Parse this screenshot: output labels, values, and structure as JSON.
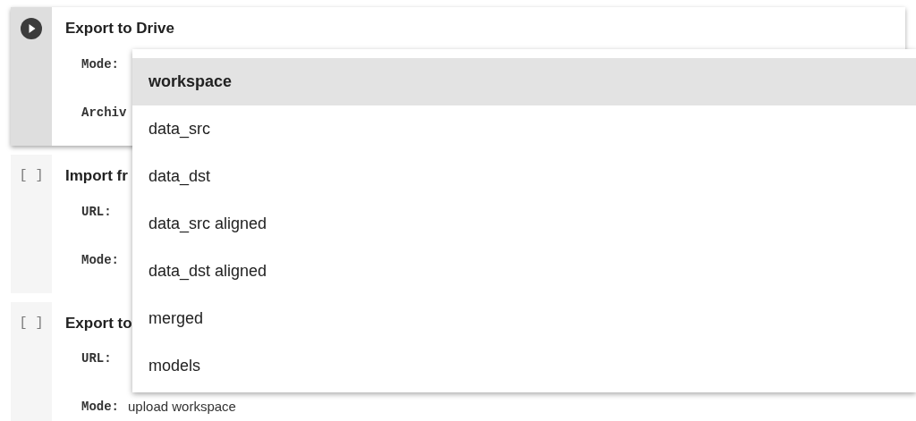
{
  "cells": [
    {
      "running": true,
      "title": "Export to Drive",
      "fields": [
        {
          "label": "Mode:"
        },
        {
          "label": "Archiv"
        }
      ]
    },
    {
      "running": false,
      "marker": "[ ]",
      "title": "Import fr",
      "fields": [
        {
          "label": "URL:"
        },
        {
          "label": "Mode:"
        }
      ]
    },
    {
      "running": false,
      "marker": "[ ]",
      "title": "Export to",
      "fields": [
        {
          "label": "URL:"
        },
        {
          "label": "Mode:",
          "value": "upload workspace"
        }
      ]
    }
  ],
  "dropdown": {
    "options": [
      {
        "label": "workspace",
        "selected": true
      },
      {
        "label": "data_src",
        "selected": false
      },
      {
        "label": "data_dst",
        "selected": false
      },
      {
        "label": "data_src aligned",
        "selected": false
      },
      {
        "label": "data_dst aligned",
        "selected": false
      },
      {
        "label": "merged",
        "selected": false
      },
      {
        "label": "models",
        "selected": false
      }
    ]
  }
}
